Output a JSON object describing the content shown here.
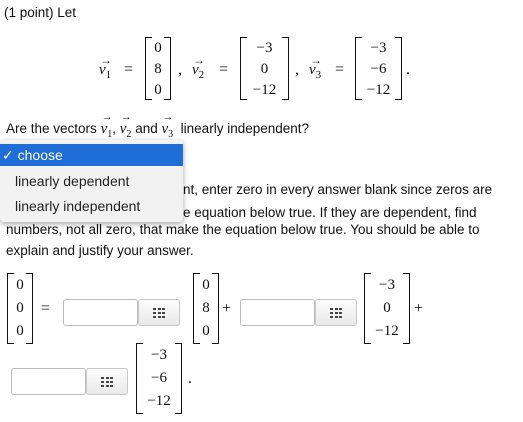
{
  "header": {
    "points": "(1 point) Let"
  },
  "definition": {
    "v1_label": "v",
    "v1_sub": "1",
    "v2_label": "v",
    "v2_sub": "2",
    "v3_label": "v",
    "v3_sub": "3",
    "v1": [
      "0",
      "8",
      "0"
    ],
    "v2": [
      "-3",
      "0",
      "-12"
    ],
    "v3": [
      "-3",
      "-6",
      "-12"
    ],
    "equals": "=",
    "comma": ",",
    "period": "."
  },
  "question": {
    "prefix": "Are the vectors",
    "and": "and",
    "suffix": "linearly independent?"
  },
  "dropdown": {
    "selected": "choose",
    "options": [
      "choose",
      "linearly dependent",
      "linearly independent"
    ]
  },
  "instructions": {
    "line1": "nt, enter zero in every answer blank since zeros are",
    "line2": "e equation below true. If they are dependent, find",
    "line3": "numbers, not all zero, that make the equation below true. You should be able to",
    "line4": "explain and justify your answer."
  },
  "equation": {
    "zero_vector": [
      "0",
      "0",
      "0"
    ],
    "v1": [
      "0",
      "8",
      "0"
    ],
    "v2": [
      "-3",
      "0",
      "-12"
    ],
    "v3": [
      "-3",
      "-6",
      "-12"
    ],
    "equals": "=",
    "plus": "+",
    "period": "."
  },
  "icons": {
    "matrix_button": "grid-icon",
    "vector_arrow": "arrow-icon"
  }
}
